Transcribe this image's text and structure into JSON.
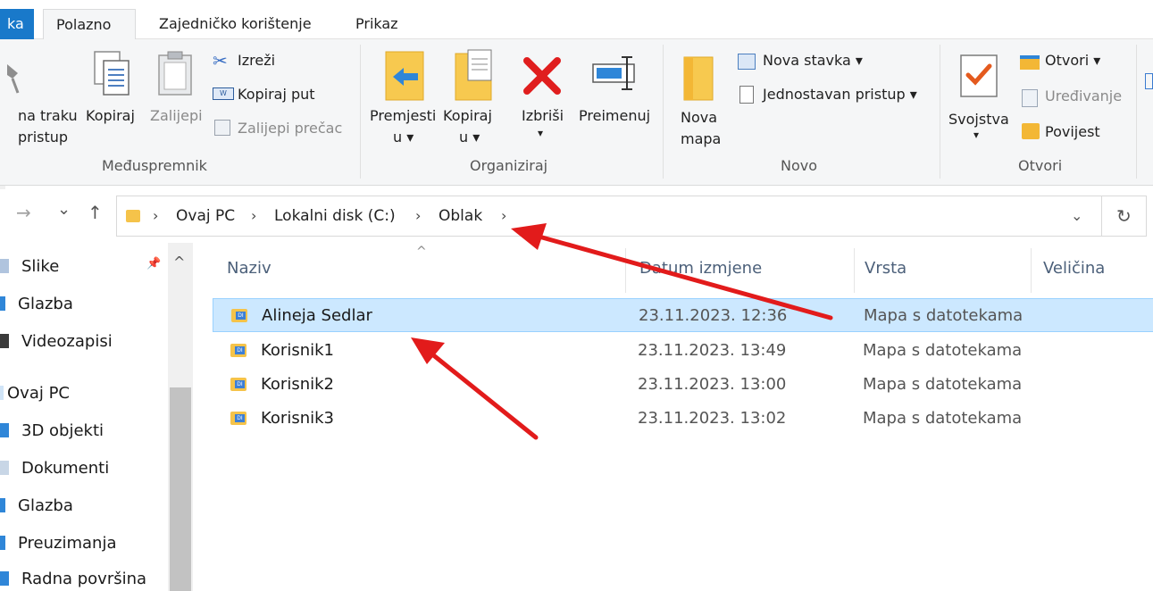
{
  "ribbon_tabs": {
    "file": "ka",
    "home": "Polazno",
    "share": "Zajedničko korištenje",
    "view": "Prikaz"
  },
  "clipboard": {
    "pin_line1": "na traku",
    "pin_line2": "pristup",
    "copy": "Kopiraj",
    "paste": "Zalijepi",
    "cut": "Izreži",
    "copy_path": "Kopiraj put",
    "paste_shortcut": "Zalijepi prečac",
    "group": "Međuspremnik"
  },
  "organize": {
    "move_line1": "Premjesti",
    "move_line2": "u ▾",
    "copy_line1": "Kopiraj",
    "copy_line2": "u ▾",
    "delete": "Izbriši",
    "delete_caret": "▾",
    "rename": "Preimenuj",
    "group": "Organiziraj"
  },
  "new": {
    "folder_line1": "Nova",
    "folder_line2": "mapa",
    "new_item": "Nova stavka ▾",
    "easy_access": "Jednostavan pristup ▾",
    "group": "Novo"
  },
  "open": {
    "properties": "Svojstva",
    "properties_caret": "▾",
    "open": "Otvori ▾",
    "edit": "Uređivanje",
    "history": "Povijest",
    "group": "Otvori"
  },
  "address": {
    "crumbs": [
      "Ovaj PC",
      "Lokalni disk (C:)",
      "Oblak"
    ],
    "sep": "›",
    "back": "→",
    "recent": "⌄",
    "up": "↑",
    "dropdown": "⌄",
    "refresh": "↻"
  },
  "sidebar": {
    "pin": "📌",
    "collapse": "^",
    "items": [
      "Slike",
      "Glazba",
      "Videozapisi",
      "Ovaj PC",
      "3D objekti",
      "Dokumenti",
      "Glazba",
      "Preuzimanja",
      "Radna površina"
    ]
  },
  "columns": {
    "name": "Naziv",
    "date": "Datum izmjene",
    "type": "Vrsta",
    "size": "Veličina",
    "sort": "^"
  },
  "files": [
    {
      "name": "Alineja Sedlar",
      "date": "23.11.2023. 12:36",
      "type": "Mapa s datotekama"
    },
    {
      "name": "Korisnik1",
      "date": "23.11.2023. 13:49",
      "type": "Mapa s datotekama"
    },
    {
      "name": "Korisnik2",
      "date": "23.11.2023. 13:00",
      "type": "Mapa s datotekama"
    },
    {
      "name": "Korisnik3",
      "date": "23.11.2023. 13:02",
      "type": "Mapa s datotekama"
    }
  ],
  "colors": {
    "accent": "#1979ca",
    "selection": "#cce8ff",
    "annotation": "#e21b1b"
  }
}
